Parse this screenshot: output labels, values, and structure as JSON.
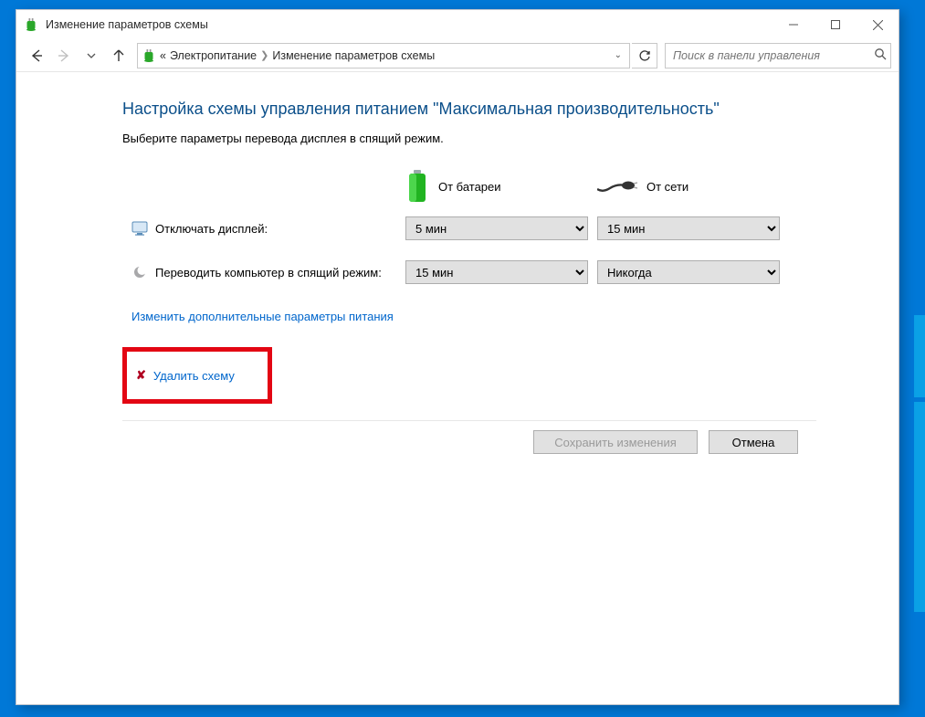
{
  "titlebar": {
    "title": "Изменение параметров схемы"
  },
  "breadcrumb": {
    "prefix": "«",
    "item1": "Электропитание",
    "item2": "Изменение параметров схемы"
  },
  "search": {
    "placeholder": "Поиск в панели управления"
  },
  "page": {
    "heading": "Настройка схемы управления питанием \"Максимальная производительность\"",
    "subtitle": "Выберите параметры перевода дисплея в спящий режим."
  },
  "columns": {
    "battery": "От батареи",
    "plugged": "От сети"
  },
  "rows": {
    "display_off": "Отключать дисплей:",
    "sleep": "Переводить компьютер в спящий режим:"
  },
  "values": {
    "display_off_battery": "5 мин",
    "display_off_plugged": "15 мин",
    "sleep_battery": "15 мин",
    "sleep_plugged": "Никогда"
  },
  "links": {
    "advanced": "Изменить дополнительные параметры питания",
    "delete": "Удалить схему"
  },
  "buttons": {
    "save": "Сохранить изменения",
    "cancel": "Отмена"
  }
}
